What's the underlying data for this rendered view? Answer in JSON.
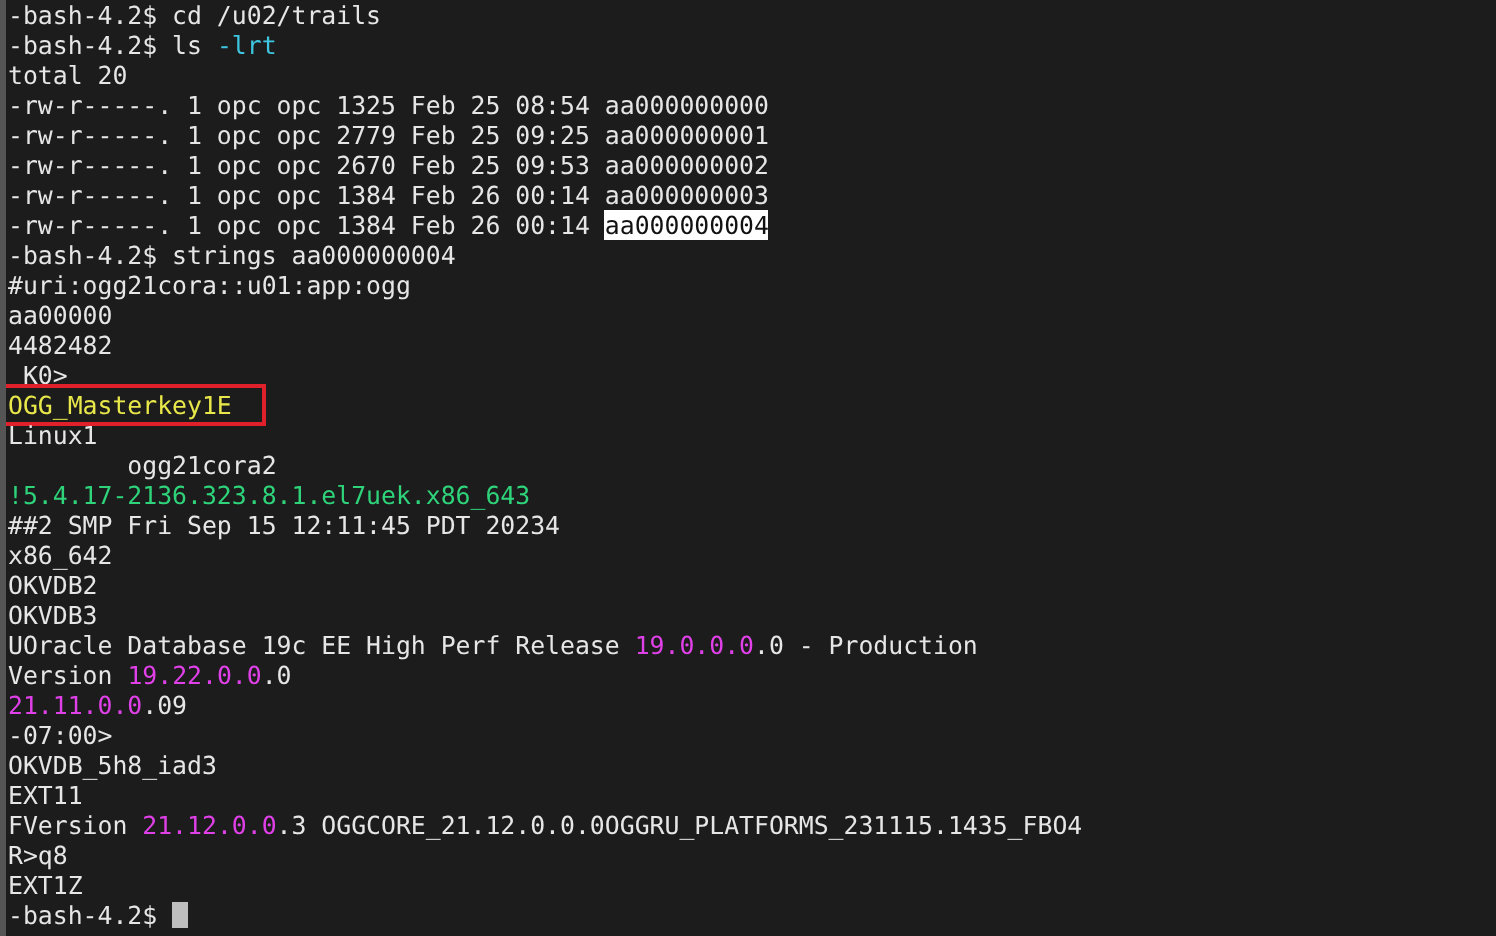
{
  "terminal": {
    "lines": [
      {
        "segments": [
          {
            "text": "-bash-4.2$ cd /u02/trails",
            "kind": "plain"
          }
        ]
      },
      {
        "segments": [
          {
            "text": "-bash-4.2$ ls ",
            "kind": "plain"
          },
          {
            "text": "-lrt",
            "kind": "cyan"
          }
        ]
      },
      {
        "segments": [
          {
            "text": "total 20",
            "kind": "plain"
          }
        ]
      },
      {
        "segments": [
          {
            "text": "-rw-r-----. 1 opc opc 1325 Feb 25 08:54 aa000000000",
            "kind": "plain"
          }
        ]
      },
      {
        "segments": [
          {
            "text": "-rw-r-----. 1 opc opc 2779 Feb 25 09:25 aa000000001",
            "kind": "plain"
          }
        ]
      },
      {
        "segments": [
          {
            "text": "-rw-r-----. 1 opc opc 2670 Feb 25 09:53 aa000000002",
            "kind": "plain"
          }
        ]
      },
      {
        "segments": [
          {
            "text": "-rw-r-----. 1 opc opc 1384 Feb 26 00:14 aa000000003",
            "kind": "plain"
          }
        ]
      },
      {
        "segments": [
          {
            "text": "-rw-r-----. 1 opc opc 1384 Feb 26 00:14 ",
            "kind": "plain"
          },
          {
            "text": "aa000000004",
            "kind": "selected"
          }
        ]
      },
      {
        "segments": [
          {
            "text": "-bash-4.2$ strings aa000000004",
            "kind": "plain"
          }
        ]
      },
      {
        "segments": [
          {
            "text": "#uri:ogg21cora::u01:app:ogg",
            "kind": "plain"
          }
        ]
      },
      {
        "segments": [
          {
            "text": "aa00000",
            "kind": "plain"
          }
        ]
      },
      {
        "segments": [
          {
            "text": "4482482",
            "kind": "plain"
          }
        ]
      },
      {
        "segments": [
          {
            "text": " K0>",
            "kind": "plain"
          }
        ]
      },
      {
        "boxed": true,
        "segments": [
          {
            "text": "OGG_Masterkey1E",
            "kind": "yellow"
          }
        ]
      },
      {
        "segments": [
          {
            "text": "Linux1",
            "kind": "plain"
          }
        ]
      },
      {
        "segments": [
          {
            "text": "        ogg21cora2",
            "kind": "plain"
          }
        ]
      },
      {
        "segments": [
          {
            "text": "!5.4.17-2136.323.8.1.el7uek.x86_643",
            "kind": "green"
          }
        ]
      },
      {
        "segments": [
          {
            "text": "##2 SMP Fri Sep 15 12:11:45 PDT 20234",
            "kind": "plain"
          }
        ]
      },
      {
        "segments": [
          {
            "text": "x86_642",
            "kind": "plain"
          }
        ]
      },
      {
        "segments": [
          {
            "text": "OKVDB2",
            "kind": "plain"
          }
        ]
      },
      {
        "segments": [
          {
            "text": "OKVDB3",
            "kind": "plain"
          }
        ]
      },
      {
        "segments": [
          {
            "text": "UOracle Database 19c EE High Perf Release ",
            "kind": "plain"
          },
          {
            "text": "19.0.0.0",
            "kind": "magenta"
          },
          {
            "text": ".0 - Production",
            "kind": "plain"
          }
        ]
      },
      {
        "segments": [
          {
            "text": "Version ",
            "kind": "plain"
          },
          {
            "text": "19.22.0.0",
            "kind": "magenta"
          },
          {
            "text": ".0",
            "kind": "plain"
          }
        ]
      },
      {
        "segments": [
          {
            "text": "21.11.0.0",
            "kind": "magenta"
          },
          {
            "text": ".09",
            "kind": "plain"
          }
        ]
      },
      {
        "segments": [
          {
            "text": "-07:00>",
            "kind": "plain"
          }
        ]
      },
      {
        "segments": [
          {
            "text": "OKVDB_5h8_iad3",
            "kind": "plain"
          }
        ]
      },
      {
        "segments": [
          {
            "text": "EXT11",
            "kind": "plain"
          }
        ]
      },
      {
        "segments": [
          {
            "text": "FVersion ",
            "kind": "plain"
          },
          {
            "text": "21.12.0.0",
            "kind": "magenta"
          },
          {
            "text": ".3 OGGCORE_21.12.0.0.0OGGRU_PLATFORMS_231115.1435_FBO4",
            "kind": "plain"
          }
        ]
      },
      {
        "segments": [
          {
            "text": "R>q8",
            "kind": "plain"
          }
        ]
      },
      {
        "segments": [
          {
            "text": "EXT1Z",
            "kind": "plain"
          }
        ]
      },
      {
        "cursor": true,
        "segments": [
          {
            "text": "-bash-4.2$ ",
            "kind": "plain"
          }
        ]
      }
    ]
  }
}
